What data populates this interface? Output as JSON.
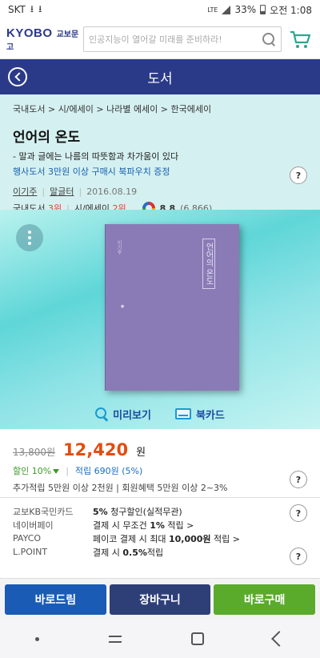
{
  "status": {
    "carrier": "SKT",
    "lte": "LTE",
    "battery": "33%",
    "time": "오전 1:08"
  },
  "header": {
    "logo_en": "KYOBO",
    "logo_kr": "교보문고",
    "search_placeholder": "인공지능이 열어갈 미래를 준비하라!"
  },
  "page_title": "도서",
  "book": {
    "breadcrumb": "국내도서 > 시/에세이 > 나라별 에세이 > 한국에세이",
    "title": "언어의 온도",
    "subtitle": "- 말과 글에는 나름의 따뜻함과 차가움이 있다",
    "promo": "행사도서 3만원 이상 구매시 북파우치 증정",
    "author": "이기주",
    "publisher": "말글터",
    "date": "2016.08.19",
    "rank_domestic_label": "국내도서",
    "rank_domestic": "3위",
    "rank_essay_label": "시/에세이",
    "rank_essay": "2위",
    "rating": "8.8",
    "rating_count": "(6,866)",
    "cover_title": "언어의 온도"
  },
  "preview": {
    "preview_label": "미리보기",
    "bookcard_label": "북카드"
  },
  "price": {
    "original": "13,800원",
    "sale": "12,420",
    "currency": "원",
    "discount": "할인 10%",
    "points": "적립 690원 (5%)",
    "extra": "추가적립 5만원 이상 2천원 | 회원혜택 5만원 이상 2~3%"
  },
  "benefits": [
    {
      "label": "교보KB국민카드",
      "text_bold": "5%",
      "text": " 청구할인(실적무관)"
    },
    {
      "label": "네이버페이",
      "text": "결제 시 무조건 ",
      "text_bold": "1%",
      "text2": " 적립 >"
    },
    {
      "label": "PAYCO",
      "text": "페이코 결제 시 최대 ",
      "text_bold": "10,000원",
      "text2": " 적립 >"
    },
    {
      "label": "L.POINT",
      "text": "결제 시 ",
      "text_bold": "0.5%",
      "text2": "적립"
    }
  ],
  "actions": {
    "direct": "바로드림",
    "cart": "장바구니",
    "buy": "바로구매"
  },
  "help_label": "?"
}
